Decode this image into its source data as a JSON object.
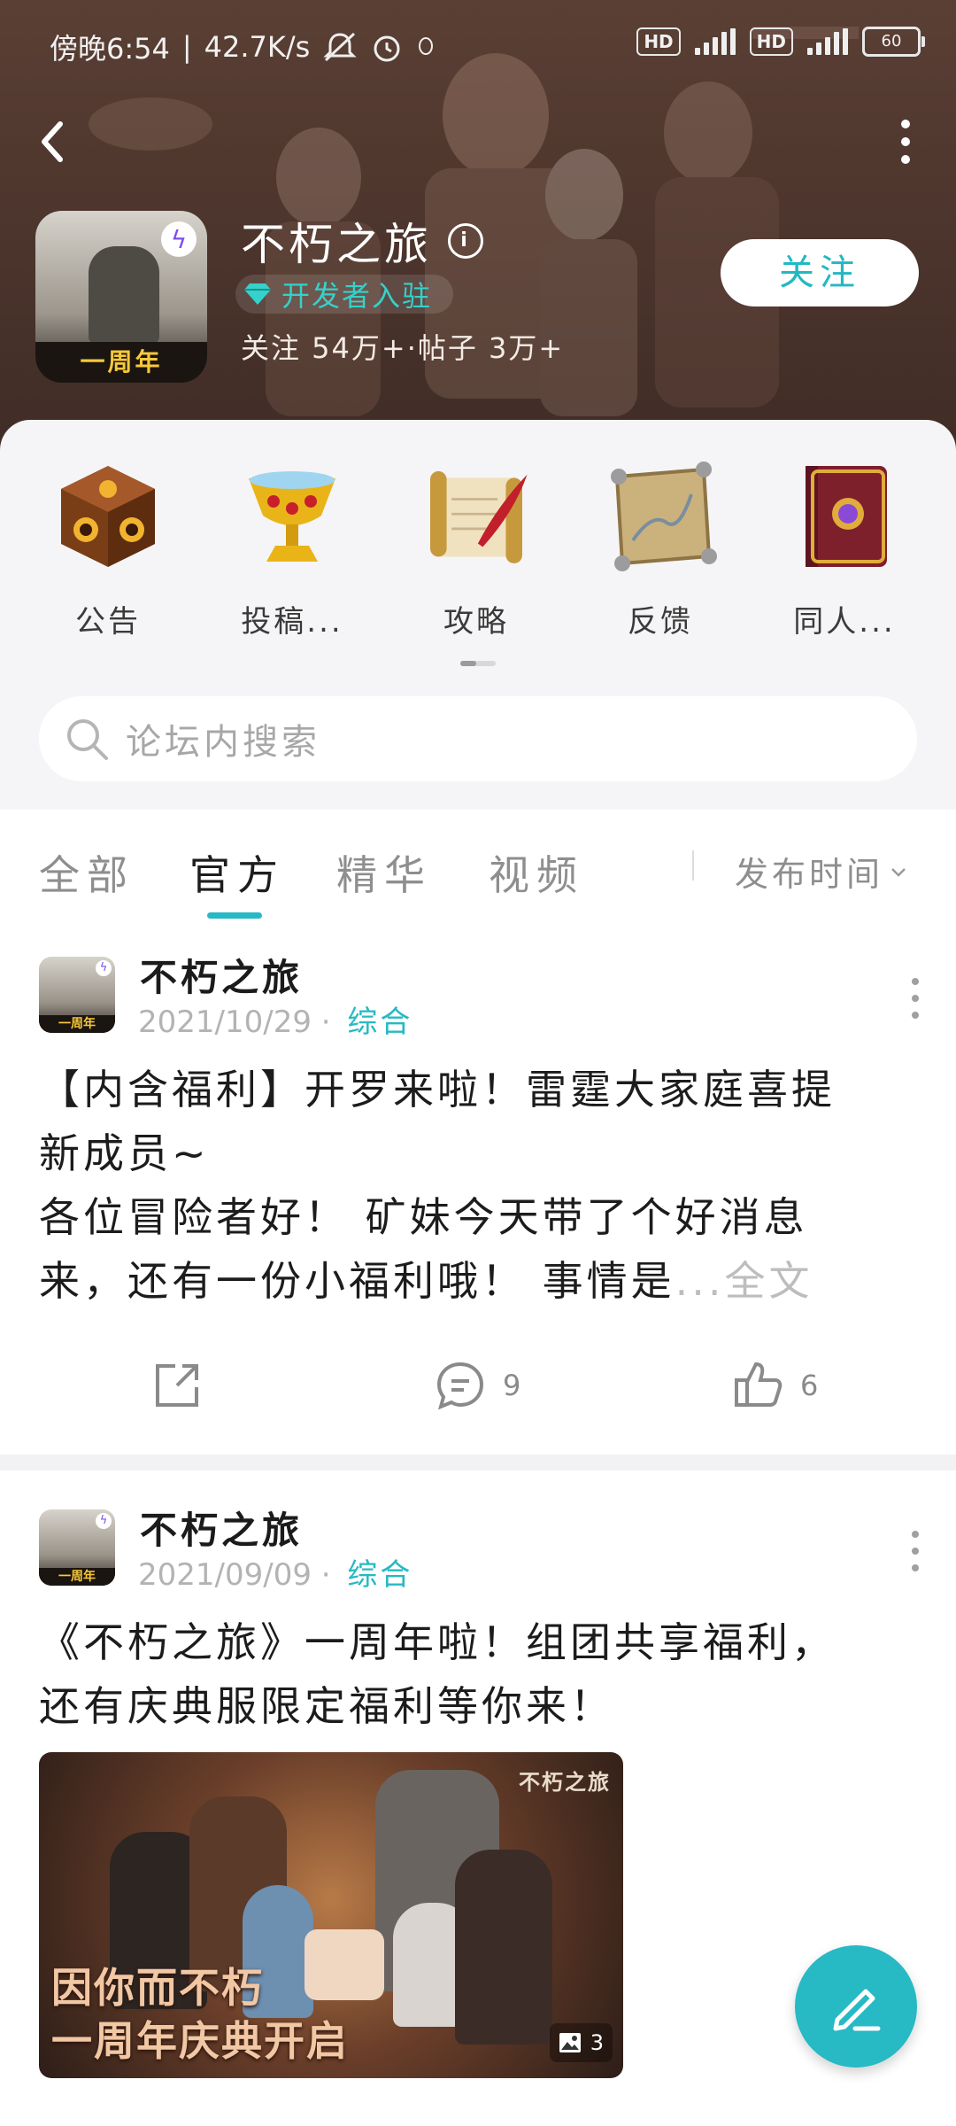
{
  "status_bar": {
    "time": "傍晚6:54",
    "net_speed": "42.7K/s",
    "hd1": "HD",
    "hd2": "HD",
    "battery": "60"
  },
  "header": {
    "forum_name": "不朽之旅",
    "dev_badge": "开发者入驻",
    "stats": "关注 54万+·帖子 3万+",
    "follow_label": "关注",
    "icon_band": "一周年"
  },
  "categories": [
    {
      "label": "公告",
      "icon": "cube-icon"
    },
    {
      "label": "投稿...",
      "icon": "chalice-icon"
    },
    {
      "label": "攻略",
      "icon": "scroll-quill-icon"
    },
    {
      "label": "反馈",
      "icon": "map-icon"
    },
    {
      "label": "同人...",
      "icon": "book-icon"
    }
  ],
  "search": {
    "placeholder": "论坛内搜索"
  },
  "tabs": [
    "全部",
    "官方",
    "精华",
    "视频"
  ],
  "active_tab": "官方",
  "sort_label": "发布时间",
  "posts": [
    {
      "author": "不朽之旅",
      "date": "2021/10/29",
      "separator": "·",
      "tag": "综合",
      "line1": "【内含福利】开罗来啦！雷霆大家庭喜提",
      "line2": "新成员~",
      "line3": "各位冒险者好！ 矿妹今天带了个好消息",
      "line4": "来，还有一份小福利哦！ 事情是",
      "ellipsis": "...",
      "full_text": "全文",
      "comments": "9",
      "likes": "6"
    },
    {
      "author": "不朽之旅",
      "date": "2021/09/09",
      "separator": "·",
      "tag": "综合",
      "line1": "《不朽之旅》一周年啦！组团共享福利，",
      "line2": "还有庆典服限定福利等你来！",
      "image_logo": "不朽之旅",
      "image_caption1": "因你而不朽",
      "image_caption2": "一周年庆典开启",
      "image_count": "3"
    }
  ],
  "colors": {
    "accent": "#27b9c4",
    "header_bg": "#4b342c"
  }
}
